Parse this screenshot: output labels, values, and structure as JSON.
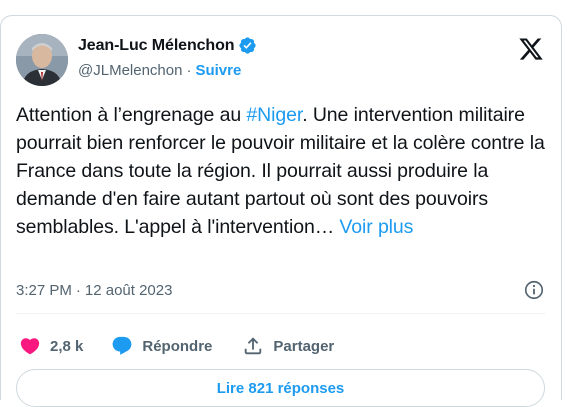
{
  "author": {
    "name": "Jean-Luc Mélenchon",
    "handle": "@JLMelenchon",
    "separator": "·",
    "follow_label": "Suivre"
  },
  "tweet": {
    "text_before": "Attention à l’engrenage au ",
    "hashtag": "#Niger",
    "text_after": ". Une intervention militaire pourrait bien renforcer le pouvoir militaire et la colère contre la France dans toute la région. Il pourrait aussi produire la demande d'en faire autant partout où sont des pouvoirs semblables. L'appel à l'intervention… ",
    "more_label": "Voir plus"
  },
  "meta": {
    "time": "3:27 PM",
    "separator": "·",
    "date": "12 août 2023"
  },
  "actions": {
    "likes_count": "2,8 k",
    "reply_label": "Répondre",
    "share_label": "Partager"
  },
  "read_replies_label": "Lire 821 réponses",
  "colors": {
    "accent": "#1d9bf0",
    "like": "#f91880",
    "text": "#0f1419",
    "secondary": "#536471"
  },
  "icons": [
    "verified-badge-icon",
    "x-logo-icon",
    "info-icon",
    "heart-icon",
    "reply-bubble-icon",
    "share-icon"
  ]
}
